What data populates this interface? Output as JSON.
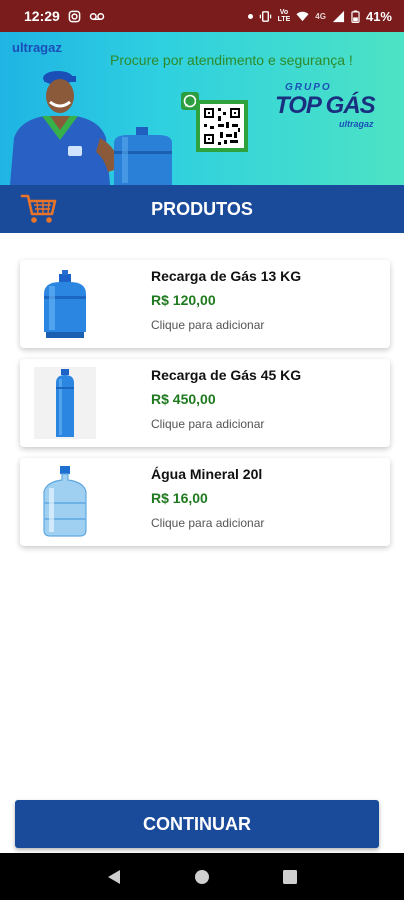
{
  "status_bar": {
    "time": "12:29",
    "network_label": "4G",
    "battery": "41%"
  },
  "banner": {
    "brand": "ultragaz",
    "headline": "Procure por atendimento e segurança !",
    "logo_group": "GRUPO",
    "logo_name": "TOP GÁS",
    "logo_sub": "ultragaz"
  },
  "header": {
    "title": "PRODUTOS",
    "cart_icon": "shopping-cart-icon"
  },
  "products": [
    {
      "name": "Recarga de Gás 13 KG",
      "price": "R$ 120,00",
      "hint": "Clique para adicionar",
      "image": "gas-cylinder-13kg"
    },
    {
      "name": "Recarga de Gás 45 KG",
      "price": "R$ 450,00",
      "hint": "Clique para adicionar",
      "image": "gas-cylinder-45kg"
    },
    {
      "name": "Água Mineral 20l",
      "price": "R$ 16,00",
      "hint": "Clique para adicionar",
      "image": "water-jug-20l"
    }
  ],
  "footer": {
    "continue_label": "CONTINUAR"
  },
  "colors": {
    "primary": "#1a4a9a",
    "price": "#1f7a1f",
    "status_bar": "#7a1c1c",
    "cart_accent": "#e8742a"
  }
}
